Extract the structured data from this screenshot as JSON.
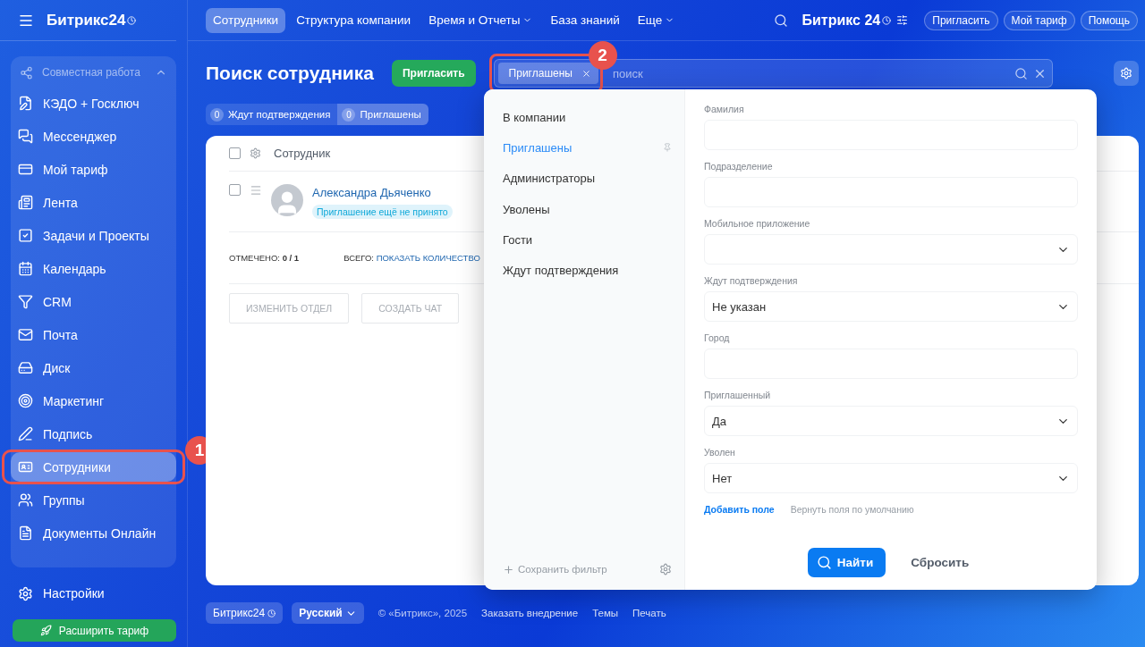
{
  "sidebar": {
    "logo": "Битрикс24",
    "group": {
      "label": "Совместная работа",
      "expanded": true
    },
    "items": [
      {
        "label": "КЭДО + Госключ",
        "selected": false
      },
      {
        "label": "Мессенджер",
        "selected": false
      },
      {
        "label": "Мой тариф",
        "selected": false
      },
      {
        "label": "Лента",
        "selected": false
      },
      {
        "label": "Задачи и Проекты",
        "selected": false
      },
      {
        "label": "Календарь",
        "selected": false
      },
      {
        "label": "CRM",
        "selected": false
      },
      {
        "label": "Почта",
        "selected": false
      },
      {
        "label": "Диск",
        "selected": false
      },
      {
        "label": "Маркетинг",
        "selected": false
      },
      {
        "label": "Подпись",
        "selected": false
      },
      {
        "label": "Сотрудники",
        "selected": true,
        "callout": "1"
      },
      {
        "label": "Группы",
        "selected": false
      },
      {
        "label": "Документы Онлайн",
        "selected": false
      }
    ],
    "settings": "Настройки",
    "upgrade_button": "Расширить тариф"
  },
  "top_nav": {
    "tabs": [
      {
        "label": "Сотрудники",
        "selected": true,
        "dropdown": false
      },
      {
        "label": "Структура компании",
        "selected": false,
        "dropdown": false
      },
      {
        "label": "Время и Отчеты",
        "selected": false,
        "dropdown": true
      },
      {
        "label": "База знаний",
        "selected": false,
        "dropdown": false
      },
      {
        "label": "Еще",
        "selected": false,
        "dropdown": true
      }
    ],
    "logo": "Битрикс 24",
    "buttons": [
      "Пригласить",
      "Мой тариф",
      "Помощь"
    ]
  },
  "page": {
    "title": "Поиск сотрудника",
    "invite_button": "Пригласить",
    "filter": {
      "chip": "Приглашены",
      "chip_callout": "2",
      "placeholder": "поиск"
    },
    "counters": [
      {
        "count": "0",
        "label": "Ждут подтверждения",
        "selected": false
      },
      {
        "count": "0",
        "label": "Приглашены",
        "selected": true
      }
    ]
  },
  "grid": {
    "columns": [
      "Сотрудник"
    ],
    "header_checked": false,
    "rows": [
      {
        "name": "Александра Дьяченко",
        "badge": "Приглашение ещё не принято",
        "checked": false
      }
    ],
    "selected_label": "ОТМЕЧЕНО:",
    "selected_value": "0 / 1",
    "total_label": "ВСЕГО:",
    "total_link": "ПОКАЗАТЬ КОЛИЧЕСТВО",
    "actions": [
      "ИЗМЕНИТЬ ОТДЕЛ",
      "СОЗДАТЬ ЧАТ"
    ]
  },
  "filter_popup": {
    "presets": [
      {
        "label": "В компании",
        "selected": false
      },
      {
        "label": "Приглашены",
        "selected": true
      },
      {
        "label": "Администраторы",
        "selected": false
      },
      {
        "label": "Уволены",
        "selected": false
      },
      {
        "label": "Гости",
        "selected": false
      },
      {
        "label": "Ждут подтверждения",
        "selected": false
      }
    ],
    "save_filter": "Сохранить фильтр",
    "fields": [
      {
        "label": "Фамилия",
        "kind": "text"
      },
      {
        "label": "Подразделение",
        "kind": "text"
      },
      {
        "label": "Мобильное приложение",
        "kind": "select"
      },
      {
        "label": "Ждут подтверждения",
        "kind": "select",
        "value": "Не указан"
      },
      {
        "label": "Город",
        "kind": "text"
      },
      {
        "label": "Приглашенный",
        "kind": "select",
        "value": "Да"
      },
      {
        "label": "Уволен",
        "kind": "select",
        "value": "Нет"
      }
    ],
    "add_field": "Добавить поле",
    "restore_fields": "Вернуть поля по умолчанию",
    "find_button": "Найти",
    "reset_button": "Сбросить"
  },
  "footer": {
    "logo": "Битрикс24",
    "language": "Русский",
    "copyright": "© «Битрикс», 2025",
    "links": [
      "Заказать внедрение",
      "Темы",
      "Печать"
    ]
  }
}
